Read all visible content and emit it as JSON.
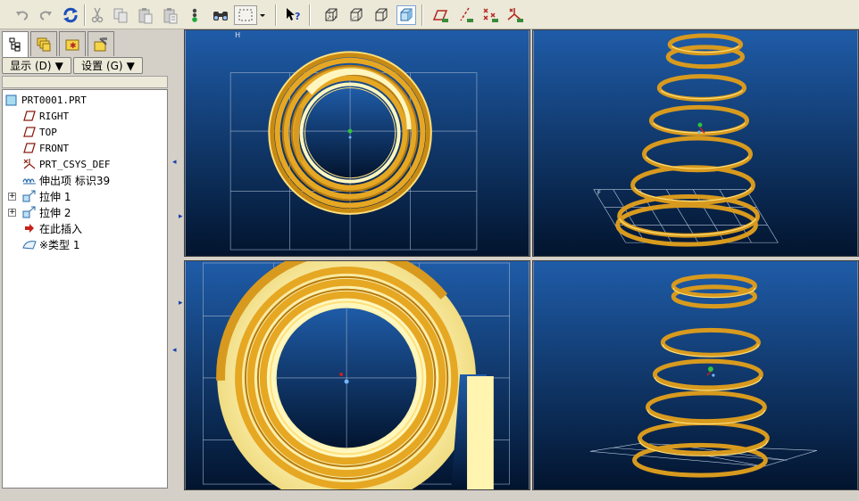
{
  "toolbar": {
    "icons": [
      "undo-icon",
      "redo-icon",
      "regenerate-icon",
      "cut-icon",
      "copy-icon",
      "paste-icon",
      "paste-special-icon",
      "traffic-light-icon",
      "binoculars-icon",
      "select-box-icon",
      "dropdown-arrow-icon",
      "context-help-icon",
      "view-wireframe-icon",
      "view-hidden-line-icon",
      "view-no-hidden-icon",
      "view-shaded-icon",
      "datum-planes-icon",
      "datum-axes-icon",
      "datum-points-icon",
      "coordinate-systems-icon"
    ]
  },
  "tabs": [
    "model-tree-tab",
    "layers-tab",
    "favorites-tab",
    "tools-tab"
  ],
  "menu": {
    "show_label": "显示 (D)",
    "settings_label": "设置 (G)"
  },
  "tree": {
    "items": [
      {
        "label": "PRT0001.PRT",
        "icon": "part-icon"
      },
      {
        "label": "RIGHT",
        "icon": "datum-plane-icon"
      },
      {
        "label": "TOP",
        "icon": "datum-plane-icon"
      },
      {
        "label": "FRONT",
        "icon": "datum-plane-icon"
      },
      {
        "label": "PRT_CSYS_DEF",
        "icon": "csys-icon"
      },
      {
        "label": "伸出项 标识39",
        "icon": "protrusion-icon"
      },
      {
        "label": "拉伸 1",
        "icon": "extrude-icon"
      },
      {
        "label": "拉伸 2",
        "icon": "extrude-icon"
      },
      {
        "label": "在此插入",
        "icon": "insert-here-icon"
      },
      {
        "label": "※类型 1",
        "icon": "feature-type-icon"
      }
    ]
  },
  "colors": {
    "viewport_top": "#1f5ca8",
    "viewport_bottom": "#02142e",
    "coil_gold": "#d89a1e",
    "coil_highlight": "#ffe07a",
    "face_cream": "#fff4b0"
  }
}
